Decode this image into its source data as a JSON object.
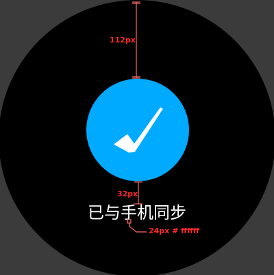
{
  "status": {
    "message": "已与手机同步",
    "icon": "checkmark-icon"
  },
  "colors": {
    "accent": "#00aaff",
    "text": "#ffffff",
    "face_background": "#000000",
    "outer_background": "#3b3b3b",
    "annotation": "#ff2a2a"
  },
  "annotations": {
    "top_gap": "112px",
    "bottom_gap": "32px",
    "font_spec": "24px  # ffffff"
  }
}
